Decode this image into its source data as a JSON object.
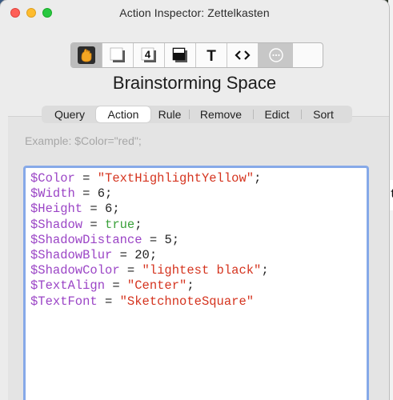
{
  "window": {
    "title": "Action Inspector: Zettelkasten"
  },
  "toolbar": {
    "buttons": [
      {
        "icon": "action-hand-icon",
        "active": true
      },
      {
        "icon": "shadow-square-icon"
      },
      {
        "icon": "number-4-icon",
        "label": "4"
      },
      {
        "icon": "dark-square-icon"
      },
      {
        "icon": "text-t-icon",
        "label": "T"
      },
      {
        "icon": "code-brackets-icon",
        "label": "<>"
      },
      {
        "icon": "more-ellipsis-icon"
      }
    ]
  },
  "panel": {
    "title": "Brainstorming Space"
  },
  "tabs": {
    "items": [
      "Query",
      "Action",
      "Rule",
      "Remove",
      "Edict",
      "Sort"
    ],
    "selected": "Action"
  },
  "editor": {
    "placeholder": "Example: $Color=\"red\";",
    "lines": [
      {
        "var": "$Color",
        "op": " = ",
        "value": "\"TextHighlightYellow\"",
        "type": "string",
        "end": ";"
      },
      {
        "var": "$Width",
        "op": " = ",
        "value": "6",
        "type": "number",
        "end": ";"
      },
      {
        "var": "$Height",
        "op": " = ",
        "value": "6",
        "type": "number",
        "end": ";"
      },
      {
        "var": "$Shadow",
        "op": " = ",
        "value": "true",
        "type": "bool",
        "end": ";"
      },
      {
        "var": "$ShadowDistance",
        "op": " = ",
        "value": "5",
        "type": "number",
        "end": ";"
      },
      {
        "var": "$ShadowBlur",
        "op": " = ",
        "value": "20",
        "type": "number",
        "end": ";"
      },
      {
        "var": "$ShadowColor",
        "op": " = ",
        "value": "\"lightest black\"",
        "type": "string",
        "end": ";"
      },
      {
        "var": "$TextAlign",
        "op": " = ",
        "value": "\"Center\"",
        "type": "string",
        "end": ";"
      },
      {
        "var": "$TextFont",
        "op": " = ",
        "value": "\"SketchnoteSquare\"",
        "type": "string",
        "end": ""
      }
    ]
  },
  "background": {
    "right_edge_char": "t"
  },
  "colors": {
    "variable": "#9b45c6",
    "string": "#d5341f",
    "boolean": "#3aa13a",
    "focus_ring": "#86a9e8"
  }
}
